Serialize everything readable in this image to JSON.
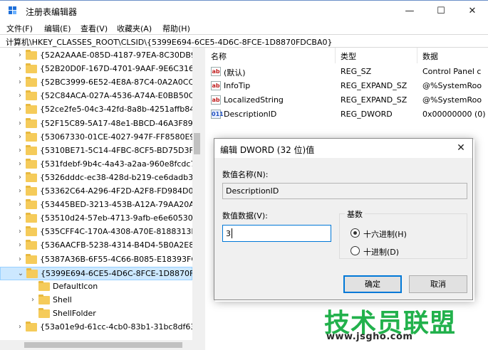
{
  "window": {
    "title": "注册表编辑器",
    "minimize_glyph": "—",
    "maximize_glyph": "☐",
    "close_glyph": "✕"
  },
  "menu": [
    "文件(F)",
    "编辑(E)",
    "查看(V)",
    "收藏夹(A)",
    "帮助(H)"
  ],
  "address": "计算机\\HKEY_CLASSES_ROOT\\CLSID\\{5399E694-6CE5-4D6C-8FCE-1D8870FDCBA0}",
  "tree": {
    "items": [
      {
        "label": "{52A2AAAE-085D-4187-97EA-8C30DB99",
        "expandable": true
      },
      {
        "label": "{52B20D0F-167D-4701-9AAF-9E6C3167",
        "expandable": true
      },
      {
        "label": "{52BC3999-6E52-4E8A-87C4-0A2A0CC3",
        "expandable": true
      },
      {
        "label": "{52C84ACA-027A-4536-A74A-E0BB50C",
        "expandable": true
      },
      {
        "label": "{52ce2fe5-04c3-42fd-8a8b-4251affb84",
        "expandable": true
      },
      {
        "label": "{52F15C89-5A17-48e1-BBCD-46A3F89",
        "expandable": true
      },
      {
        "label": "{53067330-01CE-4027-947F-FF8580E9",
        "expandable": true
      },
      {
        "label": "{5310BE71-5C14-4FBC-8CF5-BD75D3F",
        "expandable": true
      },
      {
        "label": "{531fdebf-9b4c-4a43-a2aa-960e8fcdc7",
        "expandable": true
      },
      {
        "label": "{5326dddc-ec38-428d-b219-ce6dadb3",
        "expandable": true
      },
      {
        "label": "{53362C64-A296-4F2D-A2F8-FD984D0",
        "expandable": true
      },
      {
        "label": "{53445BED-3213-453B-A12A-79AA20A",
        "expandable": true
      },
      {
        "label": "{53510d24-57eb-4713-9afb-e6e60530",
        "expandable": true
      },
      {
        "label": "{535CFF4C-170A-4308-A70E-8188313F",
        "expandable": true
      },
      {
        "label": "{536AACFB-5238-4314-B4D4-5B0A2E8",
        "expandable": true
      },
      {
        "label": "{5387A36B-6F55-4C66-B085-E18393FC",
        "expandable": true
      },
      {
        "label": "{5399E694-6CE5-4D6C-8FCE-1D8870FL",
        "expanded": true,
        "selected": true
      },
      {
        "label": "DefaultIcon",
        "child": true
      },
      {
        "label": "Shell",
        "child": true,
        "expandable": true
      },
      {
        "label": "ShellFolder",
        "child": true
      },
      {
        "label": "{53a01e9d-61cc-4cb0-83b1-31bc8df63",
        "expandable": true
      }
    ]
  },
  "list": {
    "headers": [
      "名称",
      "类型",
      "数据"
    ],
    "rows": [
      {
        "icon": "string-value-icon",
        "badge": "ab",
        "name": "(默认)",
        "type": "REG_SZ",
        "data": "Control Panel c"
      },
      {
        "icon": "string-value-icon",
        "badge": "ab",
        "name": "InfoTip",
        "type": "REG_EXPAND_SZ",
        "data": "@%SystemRoo"
      },
      {
        "icon": "string-value-icon",
        "badge": "ab",
        "name": "LocalizedString",
        "type": "REG_EXPAND_SZ",
        "data": "@%SystemRoo"
      },
      {
        "icon": "dword-value-icon",
        "badge": "011",
        "name": "DescriptionID",
        "type": "REG_DWORD",
        "data": "0x00000000 (0)"
      }
    ]
  },
  "dialog": {
    "title": "编辑 DWORD (32 位)值",
    "close_glyph": "✕",
    "name_label": "数值名称(N):",
    "name_value": "DescriptionID",
    "data_label": "数值数据(V):",
    "data_value": "3",
    "base_label": "基数",
    "radio_hex": "十六进制(H)",
    "radio_dec": "十进制(D)",
    "base_selected": "hex",
    "ok": "确定",
    "cancel": "取消"
  },
  "watermark": {
    "logo": "技术员联盟",
    "url": "www.jsgho.com"
  },
  "colors": {
    "folder": "#f5cb5a",
    "selection": "#cce8ff",
    "accent": "#0078d7",
    "watermark": "#22b14c"
  }
}
